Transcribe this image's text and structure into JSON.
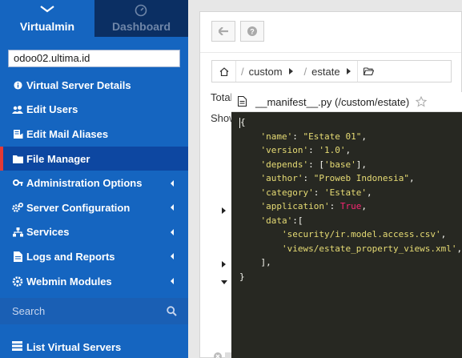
{
  "sidebar": {
    "tabs": {
      "virtualmin": "Virtualmin",
      "dashboard": "Dashboard"
    },
    "server_select": "odoo02.ultima.id",
    "items": [
      {
        "label": "Virtual Server Details",
        "icon": "info-icon",
        "submenu": false
      },
      {
        "label": "Edit Users",
        "icon": "users-icon",
        "submenu": false
      },
      {
        "label": "Edit Mail Aliases",
        "icon": "mail-alias-icon",
        "submenu": false
      },
      {
        "label": "File Manager",
        "icon": "folder-icon",
        "submenu": false,
        "active": true
      },
      {
        "label": "Administration Options",
        "icon": "key-icon",
        "submenu": true
      },
      {
        "label": "Server Configuration",
        "icon": "cogs-icon",
        "submenu": true
      },
      {
        "label": "Services",
        "icon": "sitemap-icon",
        "submenu": true
      },
      {
        "label": "Logs and Reports",
        "icon": "file-icon",
        "submenu": true
      },
      {
        "label": "Webmin Modules",
        "icon": "modules-icon",
        "submenu": true
      }
    ],
    "search_placeholder": "Search",
    "list_virtual_servers": "List Virtual Servers"
  },
  "main": {
    "breadcrumb": [
      "custom",
      "estate"
    ],
    "partial_total": "Total",
    "partial_show": "Show"
  },
  "editor": {
    "title": "__manifest__.py (/custom/estate)",
    "lines": [
      "{",
      "    'name': \"Estate 01\",",
      "    'version': '1.0',",
      "    'depends': ['base'],",
      "    'author': \"Proweb Indonesia\",",
      "    'category': 'Estate',",
      "    'application': True,",
      "    'data':[",
      "        'security/ir.model.access.csv',",
      "        'views/estate_property_views.xml',",
      "    ],",
      "}"
    ]
  },
  "colors": {
    "sidebar": "#1565c0",
    "sidebar_dark": "#0b2f63",
    "active_marker": "#e53935",
    "editor_bg": "#272822",
    "code_string": "#e6db74",
    "code_keyword": "#f92672"
  }
}
